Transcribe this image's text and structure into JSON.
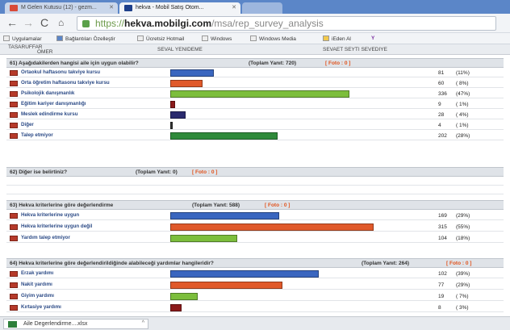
{
  "browser": {
    "tabs": [
      {
        "title": "M Gelen Kutusu (12) - gezm...",
        "icon": "gmail-icon"
      },
      {
        "title": "hekva - Mobil Satış Otom...",
        "icon": "site-icon"
      }
    ],
    "url": {
      "protocol": "https://",
      "host": "hekva.mobilgi.com",
      "path": "/msa/rep_survey_analysis"
    },
    "bookmarks": [
      "Uygulamalar",
      "Bağlantıları Özelleştir",
      "Ücretsiz Hotmail",
      "Windows",
      "Windows Media",
      "iEden Al",
      "Y"
    ]
  },
  "top_strip": {
    "left1": "TASARUFFAR",
    "left2": "OMER",
    "mid": "SEVAL YENIDEME",
    "right": "SEVAET SEYTI SEVEDIYE"
  },
  "questions": [
    {
      "title": "61) Aşağıdakilerden hangisi aile için uygun olabilir?",
      "total": "(Toplam Yanıt: 720)",
      "photo": "[ Foto : 0 ]",
      "rows": [
        {
          "label": "Ortaokul haftasonu takviye kursu",
          "count": "81",
          "pct": "(11%)",
          "value": 81,
          "color": "#3a66bf"
        },
        {
          "label": "Orta öğretim haftasonu takviye kursu",
          "count": "60",
          "pct": "( 8%)",
          "value": 60,
          "color": "#e0592a"
        },
        {
          "label": "Psikolojik danışmanlık",
          "count": "336",
          "pct": "(47%)",
          "value": 336,
          "color": "#7cbe3c"
        },
        {
          "label": "Eğitim kariyer danışmanlığı",
          "count": "9",
          "pct": "( 1%)",
          "value": 9,
          "color": "#8b1a1a"
        },
        {
          "label": "Meslek edindirme kursu",
          "count": "28",
          "pct": "( 4%)",
          "value": 28,
          "color": "#2a2a6e"
        },
        {
          "label": "Diğer",
          "count": "4",
          "pct": "( 1%)",
          "value": 4,
          "color": "#333333"
        },
        {
          "label": "Talep etmiyor",
          "count": "202",
          "pct": "(28%)",
          "value": 202,
          "color": "#2f8a3a"
        }
      ]
    },
    {
      "title": "62) Diğer ise belirtiniz?",
      "total": "(Toplam Yanıt: 0)",
      "photo": "[ Foto : 0 ]",
      "rows": []
    },
    {
      "title": "63) Hekva kriterlerine göre değerlendirme",
      "total": "(Toplam Yanıt: 588)",
      "photo": "[ Foto : 0 ]",
      "rows": [
        {
          "label": "Hekva kriterlerine uygun",
          "count": "169",
          "pct": "(29%)",
          "value": 169,
          "color": "#3a66bf"
        },
        {
          "label": "Hekva kriterlerine uygun değil",
          "count": "315",
          "pct": "(55%)",
          "value": 315,
          "color": "#e0592a"
        },
        {
          "label": "Yardım talep etmiyor",
          "count": "104",
          "pct": "(18%)",
          "value": 104,
          "color": "#7cbe3c"
        }
      ]
    },
    {
      "title": "64) Hekva kriterlerine göre değerlendirildiğinde alabileceği yardımlar hangileridir?",
      "total": "(Toplam Yanıt: 264)",
      "photo": "[ Foto : 0 ]",
      "rows": [
        {
          "label": "Erzak yardımı",
          "count": "102",
          "pct": "(39%)",
          "value": 102,
          "color": "#3a66bf"
        },
        {
          "label": "Nakit yardımı",
          "count": "77",
          "pct": "(29%)",
          "value": 77,
          "color": "#e0592a"
        },
        {
          "label": "Giyim yardımı",
          "count": "19",
          "pct": "( 7%)",
          "value": 19,
          "color": "#7cbe3c"
        },
        {
          "label": "Kırtasiye yardımı",
          "count": "8",
          "pct": "( 3%)",
          "value": 8,
          "color": "#8b1a1a"
        }
      ]
    }
  ],
  "downloads": {
    "file": "Aile Degerlendirme....xlsx"
  }
}
